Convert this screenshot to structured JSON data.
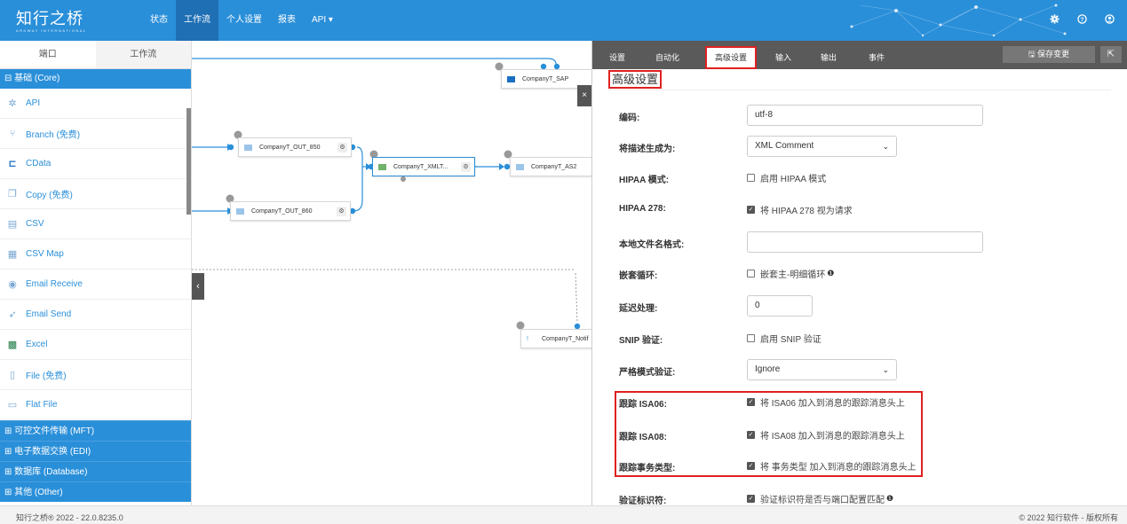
{
  "brand": {
    "name": "知行之桥",
    "tagline": "ARKWAY INTERNATIONAL",
    "accent": "#2a8fd9"
  },
  "nav": [
    {
      "label": "状态",
      "active": false
    },
    {
      "label": "工作流",
      "active": true
    },
    {
      "label": "个人设置",
      "active": false
    },
    {
      "label": "报表",
      "active": false
    },
    {
      "label": "API ▾",
      "active": false
    }
  ],
  "top_icons": [
    "gear-icon",
    "help-icon",
    "user-icon"
  ],
  "left_panel": {
    "tabs": [
      "端口",
      "工作流"
    ],
    "open_category": "⊟ 基础 (Core)",
    "items": [
      {
        "label": "API",
        "icon": "api-icon"
      },
      {
        "label": "Branch (免费)",
        "icon": "branch-icon"
      },
      {
        "label": "CData",
        "icon": "cdata-icon"
      },
      {
        "label": "Copy (免费)",
        "icon": "copy-icon"
      },
      {
        "label": "CSV",
        "icon": "csv-icon"
      },
      {
        "label": "CSV Map",
        "icon": "csv-map-icon"
      },
      {
        "label": "Email Receive",
        "icon": "email-receive-icon"
      },
      {
        "label": "Email Send",
        "icon": "email-send-icon"
      },
      {
        "label": "Excel",
        "icon": "excel-icon"
      },
      {
        "label": "File (免费)",
        "icon": "file-icon"
      },
      {
        "label": "Flat File",
        "icon": "flat-file-icon"
      }
    ],
    "closed_categories": [
      "⊞ 可控文件传输 (MFT)",
      "⊞ 电子数据交换 (EDI)",
      "⊞ 数据库 (Database)",
      "⊞ 其他 (Other)"
    ]
  },
  "canvas": {
    "nodes": [
      {
        "name": "CompanyT_SAP",
        "badge": "0"
      },
      {
        "name": "CompanyT_OUT_850",
        "badge": "0"
      },
      {
        "name": "CompanyT_XMLT...",
        "badge": "0"
      },
      {
        "name": "CompanyT_AS2",
        "badge": "0"
      },
      {
        "name": "CompanyT_OUT_860",
        "badge": "0"
      },
      {
        "name": "CompanyT_Notif",
        "badge": "0"
      }
    ]
  },
  "right_panel": {
    "tabs": [
      "设置",
      "自动化",
      "高级设置",
      "输入",
      "输出",
      "事件"
    ],
    "active_tab": "高级设置",
    "save_label": "🖫 保存变更",
    "title": "高级设置",
    "fields": {
      "encoding": {
        "label": "编码:",
        "value": "utf-8"
      },
      "describe_as": {
        "label": "将描述生成为:",
        "value": "XML Comment"
      },
      "hipaa_mode": {
        "label": "HIPAA 模式:",
        "text": "启用 HIPAA 模式",
        "checked": false
      },
      "hipaa_278": {
        "label": "HIPAA 278:",
        "text": "将 HIPAA 278 视为请求",
        "checked": true
      },
      "local_filename": {
        "label": "本地文件名格式:",
        "value": ""
      },
      "nested_loop": {
        "label": "嵌套循环:",
        "text": "嵌套主-明细循环",
        "checked": false
      },
      "delay": {
        "label": "延迟处理:",
        "value": "0"
      },
      "snip": {
        "label": "SNIP 验证:",
        "text": "启用 SNIP 验证",
        "checked": false
      },
      "strict_mode": {
        "label": "严格模式验证:",
        "value": "Ignore"
      },
      "track_isa06": {
        "label": "跟踪 ISA06:",
        "text": "将 ISA06 加入到消息的跟踪消息头上",
        "checked": true
      },
      "track_isa08": {
        "label": "跟踪 ISA08:",
        "text": "将 ISA08 加入到消息的跟踪消息头上",
        "checked": true
      },
      "track_txn": {
        "label": "跟踪事务类型:",
        "text": "将 事务类型 加入到消息的跟踪消息头上",
        "checked": true
      },
      "validate_id": {
        "label": "验证标识符:",
        "text": "验证标识符是否与端口配置匹配",
        "checked": true
      }
    }
  },
  "footer": {
    "left": "知行之桥® 2022 - 22.0.8235.0",
    "right": "© 2022 知行软件 - 版权所有"
  }
}
